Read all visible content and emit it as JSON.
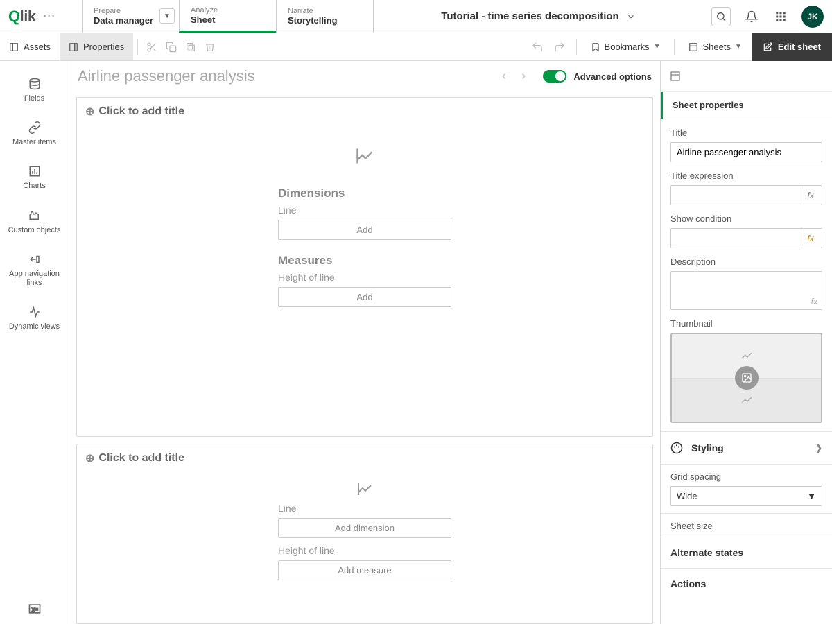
{
  "header": {
    "logo_q": "Q",
    "logo_rest": "lik",
    "tabs": {
      "prepare": {
        "small": "Prepare",
        "big": "Data manager"
      },
      "analyze": {
        "small": "Analyze",
        "big": "Sheet"
      },
      "narrate": {
        "small": "Narrate",
        "big": "Storytelling"
      }
    },
    "app_title": "Tutorial - time series decomposition",
    "avatar": "JK"
  },
  "toolbar": {
    "assets": "Assets",
    "properties": "Properties",
    "bookmarks": "Bookmarks",
    "sheets": "Sheets",
    "edit_sheet": "Edit sheet"
  },
  "left_rail": {
    "fields": "Fields",
    "master_items": "Master items",
    "charts": "Charts",
    "custom_objects": "Custom objects",
    "app_nav": "App navigation links",
    "dynamic_views": "Dynamic views"
  },
  "canvas": {
    "sheet_title": "Airline passenger analysis",
    "advanced": "Advanced options",
    "add_title": "Click to add title",
    "obj1": {
      "dimensions_h": "Dimensions",
      "dim_label": "Line",
      "add": "Add",
      "measures_h": "Measures",
      "meas_label": "Height of line"
    },
    "obj2": {
      "dim_label": "Line",
      "add_dim": "Add dimension",
      "meas_label": "Height of line",
      "add_meas": "Add measure"
    }
  },
  "props": {
    "section": "Sheet properties",
    "title_label": "Title",
    "title_value": "Airline passenger analysis",
    "title_expr": "Title expression",
    "show_cond": "Show condition",
    "description": "Description",
    "thumbnail": "Thumbnail",
    "styling": "Styling",
    "grid_spacing": "Grid spacing",
    "grid_value": "Wide",
    "sheet_size": "Sheet size",
    "alt_states": "Alternate states",
    "actions": "Actions",
    "fx": "fx"
  }
}
